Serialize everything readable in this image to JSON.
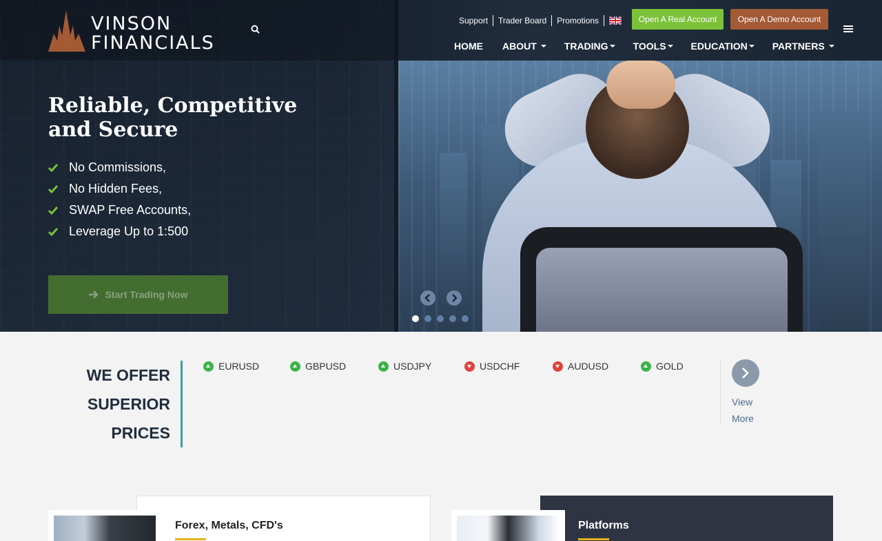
{
  "header": {
    "logo_line1": "VINSON",
    "logo_line2": "FINANCIALS",
    "top_links": [
      "Support",
      "Trader Board",
      "Promotions"
    ],
    "open_real_account": "Open A Real Account",
    "open_demo_account": "Open A Demo Account",
    "nav": [
      {
        "label": "HOME",
        "dropdown": false
      },
      {
        "label": "ABOUT",
        "dropdown": true
      },
      {
        "label": "TRADING",
        "dropdown": true
      },
      {
        "label": "TOOLS",
        "dropdown": true
      },
      {
        "label": "EDUCATION",
        "dropdown": true
      },
      {
        "label": "PARTNERS",
        "dropdown": true
      }
    ]
  },
  "hero": {
    "title": "Reliable, Competitive and Secure",
    "features": [
      "No Commissions,",
      "No Hidden Fees,",
      "SWAP Free Accounts,",
      "Leverage Up to 1:500"
    ],
    "cta": "Start Trading Now",
    "slides": 5,
    "active_slide": 1
  },
  "prices": {
    "heading_lines": [
      "WE OFFER",
      "SUPERIOR",
      "PRICES"
    ],
    "instruments": [
      {
        "symbol": "EURUSD",
        "direction": "up"
      },
      {
        "symbol": "GBPUSD",
        "direction": "up"
      },
      {
        "symbol": "USDJPY",
        "direction": "up"
      },
      {
        "symbol": "USDCHF",
        "direction": "down"
      },
      {
        "symbol": "AUDUSD",
        "direction": "down"
      },
      {
        "symbol": "GOLD",
        "direction": "up"
      }
    ],
    "view_more_line1": "View",
    "view_more_line2": "More"
  },
  "cards": {
    "card1_title": "Forex, Metals, CFD's",
    "card2_title": "Platforms"
  },
  "colors": {
    "real_account": "#7cc13a",
    "demo_account": "#a35a35",
    "accent_teal": "#3aa0a6",
    "underline_gold": "#e7b21b",
    "up": "#3bb34a",
    "down": "#e0413a"
  }
}
